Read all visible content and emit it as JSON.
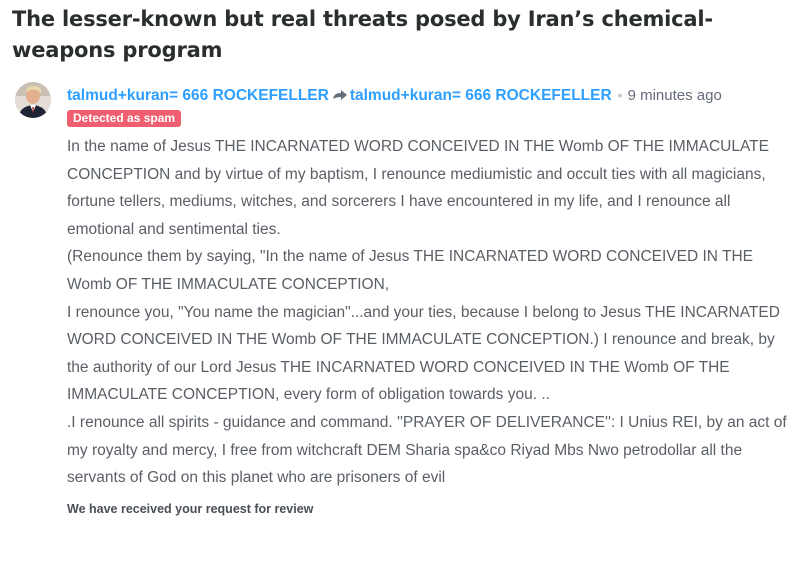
{
  "thread": {
    "title": "The lesser-known but real threats posed by Iran’s chemical-weapons program"
  },
  "post": {
    "author": "talmud+kuran= 666 ROCKEFELLER",
    "reply_to": "talmud+kuran= 666 ROCKEFELLER",
    "separator": "•",
    "timestamp": "9 minutes ago",
    "badge": "Detected as spam",
    "message": [
      "In the name of Jesus THE INCARNATED WORD CONCEIVED IN THE Womb OF THE IMMACULATE CONCEPTION and by virtue of my baptism, I renounce mediumistic and occult ties with all magicians, fortune tellers, mediums, witches, and sorcerers I have encountered in my life, and I renounce all emotional and sentimental ties.",
      "(Renounce them by saying, \"In the name of Jesus THE INCARNATED WORD CONCEIVED IN THE Womb OF THE IMMACULATE CONCEPTION,",
      "I renounce you, \"You name the magician\"...and your ties, because I belong to Jesus THE INCARNATED WORD CONCEIVED IN THE Womb OF THE IMMACULATE CONCEPTION.) I renounce and break, by the authority of our Lord Jesus THE INCARNATED WORD CONCEIVED IN THE Womb OF THE IMMACULATE CONCEPTION, every form of obligation towards you. ..",
      ".I renounce all spirits - guidance and command. ''PRAYER OF DELIVERANCE'': I Unius REI, by an act of my royalty and mercy, I free from witchcraft DEM Sharia spa&co Riyad Mbs Nwo petrodollar all the servants of God on this planet who are prisoners of evil"
    ],
    "review_notice": "We have received your request for review"
  },
  "colors": {
    "author_link": "#2e9fff",
    "badge_background": "#f05f70",
    "title": "#2a2e2e",
    "body_text": "#5a5f66"
  },
  "icons": {
    "avatar": "user-avatar-photo",
    "reply_arrow": "reply-arrow-icon"
  }
}
